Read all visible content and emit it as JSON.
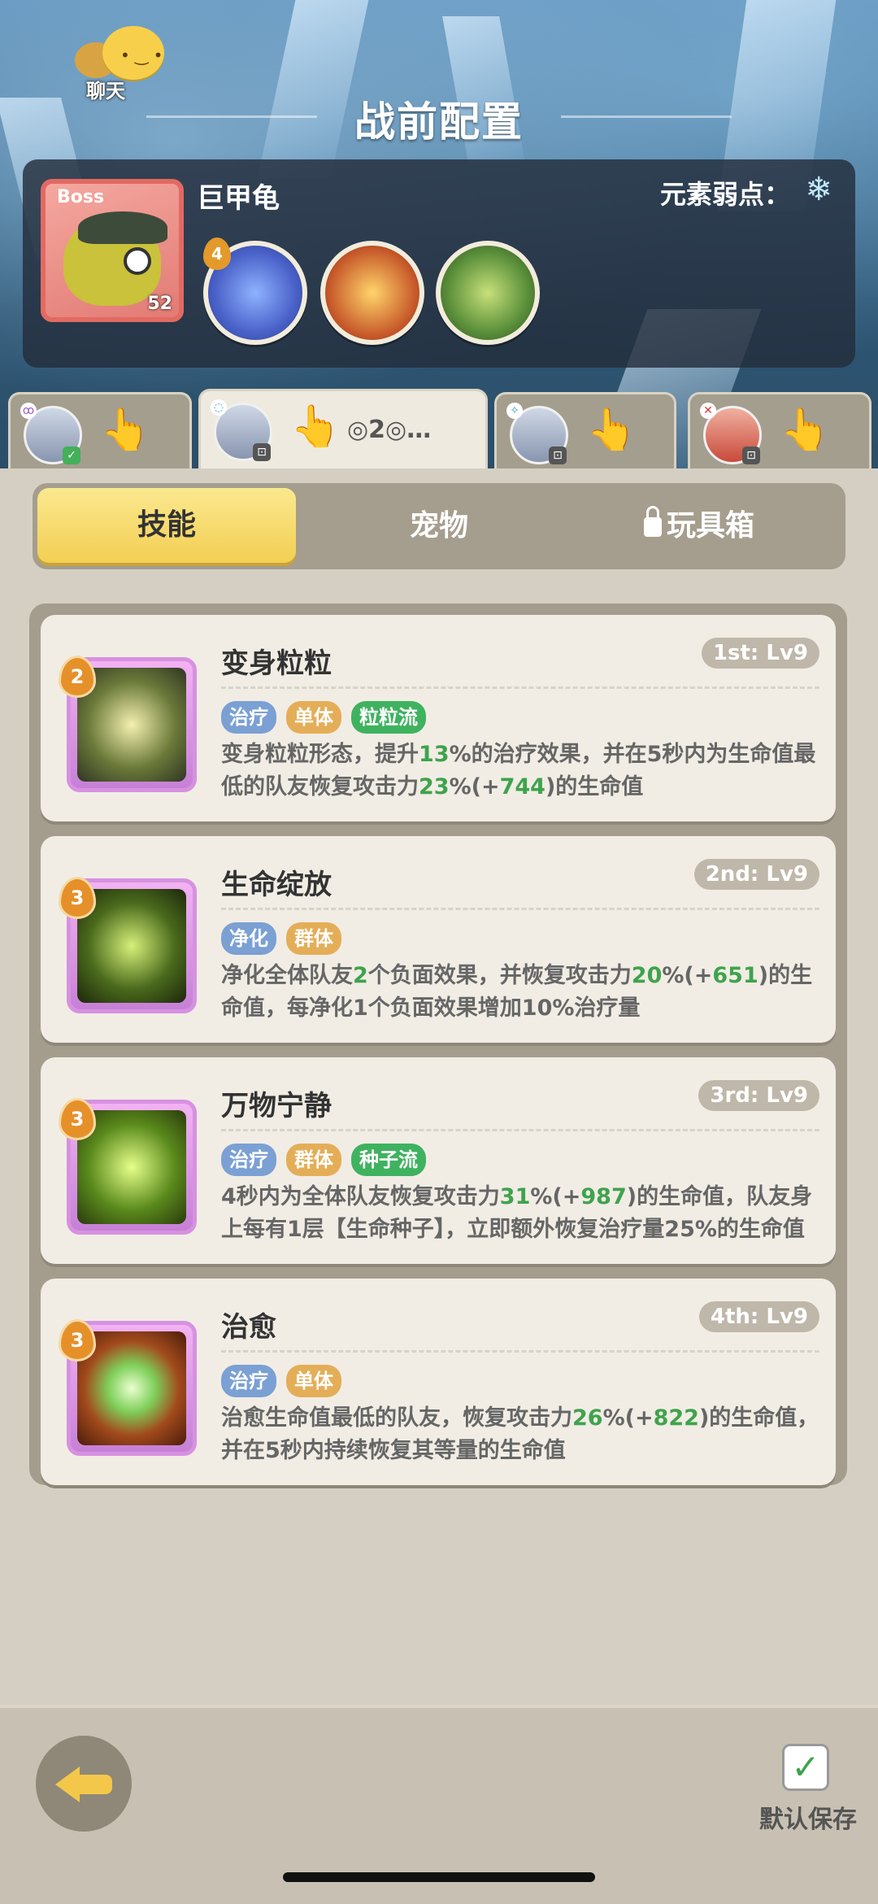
{
  "header": {
    "chat_label": "聊天",
    "title": "战前配置"
  },
  "boss": {
    "tag": "Boss",
    "name": "巨甲龟",
    "level": "52",
    "weakness_label": "元素弱点：",
    "weakness_icon": "snowflake-icon",
    "skill_orbs": [
      {
        "badge": "4",
        "icon": "swirl-orb-icon",
        "color": "#4a62c9"
      },
      {
        "badge": "",
        "icon": "spike-crown-icon",
        "color": "#c7592a"
      },
      {
        "badge": "",
        "icon": "monster-roar-icon",
        "color": "#5a8f3a"
      }
    ]
  },
  "hero_tabs": [
    {
      "label": "",
      "element": "ꝏ",
      "status": "✓"
    },
    {
      "label": "◎2◎…",
      "element": "◌",
      "status": "⊡"
    },
    {
      "label": "",
      "element": "✧",
      "status": "⊡"
    },
    {
      "label": "",
      "element": "✕",
      "status": "⊡"
    }
  ],
  "content_tabs": {
    "skills": "技能",
    "pets": "宠物",
    "toybox": "玩具箱"
  },
  "skills": [
    {
      "cost": "2",
      "name": "变身粒粒",
      "level": "1st: Lv9",
      "tags": [
        "治疗",
        "单体",
        "粒粒流"
      ],
      "desc_parts": [
        "变身粒粒形态，提升",
        "13",
        "%的治疗效果，并在5秒内为生命值最低的队友恢复攻击力",
        "23",
        "%(+",
        "744",
        ")的生命值"
      ]
    },
    {
      "cost": "3",
      "name": "生命绽放",
      "level": "2nd: Lv9",
      "tags": [
        "净化",
        "群体"
      ],
      "desc_parts": [
        "净化全体队友",
        "2",
        "个负面效果，并恢复攻击力",
        "20",
        "%(+",
        "651",
        ")的生命值，每净化1个负面效果增加10%治疗量"
      ]
    },
    {
      "cost": "3",
      "name": "万物宁静",
      "level": "3rd: Lv9",
      "tags": [
        "治疗",
        "群体",
        "种子流"
      ],
      "desc_parts": [
        "4秒内为全体队友恢复攻击力",
        "31",
        "%(+",
        "987",
        ")的生命值，队友身上每有1层【生命种子】，立即额外恢复治疗量25%的生命值"
      ]
    },
    {
      "cost": "3",
      "name": "治愈",
      "level": "4th: Lv9",
      "tags": [
        "治疗",
        "单体"
      ],
      "desc_parts": [
        "治愈生命值最低的队友，恢复攻击力",
        "26",
        "%(+",
        "822",
        ")的生命值，并在5秒内持续恢复其等量的生命值"
      ]
    }
  ],
  "bottom": {
    "save_label": "默认保存"
  }
}
